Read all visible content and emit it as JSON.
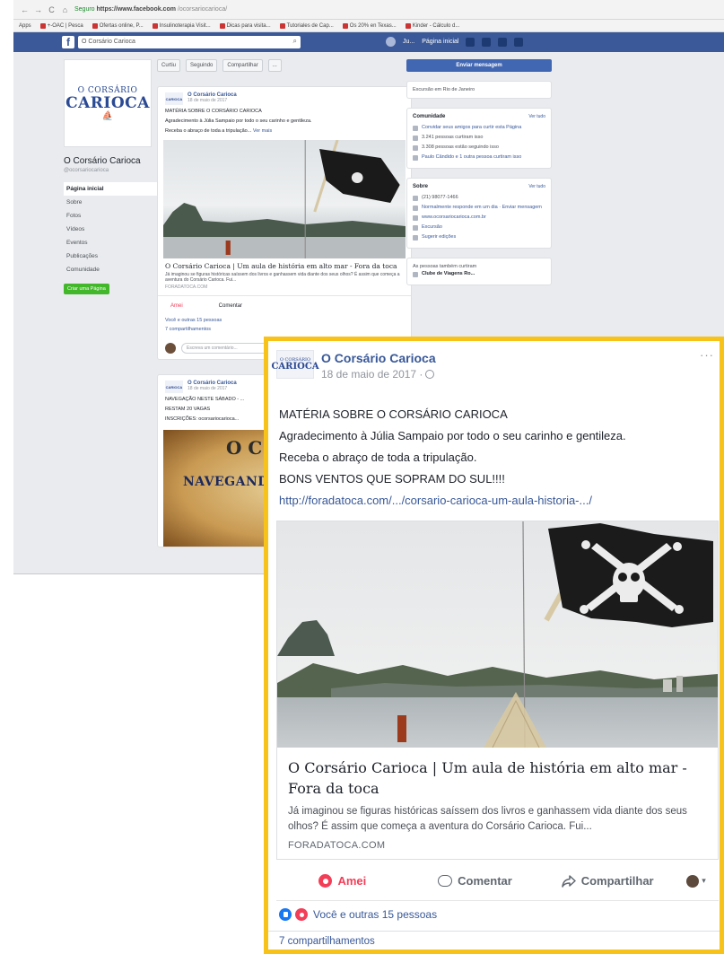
{
  "browser": {
    "nav_buttons": [
      "←",
      "→",
      "C",
      "⌂"
    ],
    "secure_label": "Seguro",
    "url_host": "https://www.facebook.com",
    "url_path": "/ocorsariocarioca/",
    "bookmarks": [
      "Apps",
      "+-OAC | Pesca",
      "Ofertas online, P...",
      "Insulinoterapia Visit...",
      "Dicas para visita...",
      "Tutoriales de Cap...",
      "Os 20% en Texas...",
      "Kinder - Cálculo d..."
    ]
  },
  "facebook": {
    "logo": "f",
    "search_value": "O Corsário Carioca",
    "search_icon": "search-icon",
    "user_name": "Ju...",
    "home_label": "Página inicial"
  },
  "page": {
    "logo_top": "O CORSÁRIO",
    "logo_main": "CARIOCA",
    "logo_ship": "⛵",
    "name": "O Corsário Carioca",
    "handle": "@ocorsariocarioca",
    "nav": [
      "Página inicial",
      "Sobre",
      "Fotos",
      "Vídeos",
      "Eventos",
      "Publicações",
      "Comunidade"
    ],
    "create_page_label": "Criar uma Página"
  },
  "actions": {
    "curtir": "Curtiu",
    "seguir": "Seguindo",
    "compartilhar": "Compartilhar",
    "more": "..."
  },
  "bg_post1": {
    "author": "O Corsário Carioca",
    "date": "18 de maio de 2017",
    "lines": [
      "MATÉRIA SOBRE O CORSÁRIO CARIOCA",
      "Agradecimento à Júlia Sampaio por todo o seu carinho e gentileza.",
      "Receba o abraço de toda a tripulação..."
    ],
    "more": "Ver mais",
    "link_title": "O Corsário Carioca | Um aula de história em alto mar - Fora da toca",
    "link_desc": "Já imaginou se figuras históricas saíssem dos livros e ganhassem vida diante dos seus olhos? É assim que começa a aventura do Corsário Carioca. Fui...",
    "link_domain": "FORADATOCA.COM",
    "amei": "Amei",
    "comentar": "Comentar",
    "likes": "Você e outras 15 pessoas",
    "shares": "7 compartilhamentos",
    "comment_placeholder": "Escreva um comentário..."
  },
  "bg_post2": {
    "author": "O Corsário Carioca",
    "date": "18 de maio de 2017",
    "lines": [
      "NAVEGAÇÃO NESTE SÁBADO - ...",
      "RESTAM 20 VAGAS",
      "INSCRIÇÕES: ocorsariocarioca..."
    ],
    "poster_logo": "O C\nCA",
    "poster_text": "NAVEGANDO"
  },
  "right": {
    "send_message": "Enviar mensagem",
    "location": "Excursão em Rio de Janeiro",
    "community_title": "Comunidade",
    "see_all": "Ver tudo",
    "community_rows": [
      "Convidar seus amigos para curtir esta Página",
      "3.241 pessoas curtiram isso",
      "3.308 pessoas estão seguindo isso",
      "Paulo Cândido e 1 outra pessoa curtiram isso"
    ],
    "about_title": "Sobre",
    "about_rows": [
      "(21) 98077-1466",
      "Normalmente responde em um dia · Enviar mensagem",
      "www.ocorsariocarioca.com.br",
      "Excursão",
      "Sugerir edições"
    ],
    "also_like": "As pessoas também curtiram",
    "suggest_name": "Clube de Viagens Ro..."
  },
  "post": {
    "avatar_top": "O CORSÁRIO",
    "avatar_main": "CARIOCA",
    "author": "O Corsário Carioca",
    "date": "18 de maio de 2017 ·",
    "menu": "···",
    "lines": [
      "MATÉRIA SOBRE O CORSÁRIO CARIOCA",
      "Agradecimento à Júlia Sampaio por todo o seu carinho e gentileza.",
      "Receba o abraço de toda a tripulação.",
      "BONS VENTOS QUE SOPRAM DO SUL!!!!"
    ],
    "link_url": "http://foradatoca.com/.../corsario-carioca-um-aula-historia-.../",
    "link_title": "O Corsário Carioca | Um aula de história em alto mar - Fora da toca",
    "link_desc": "Já imaginou se figuras históricas saíssem dos livros e ganhassem vida diante dos seus olhos? É assim que começa a aventura do Corsário Carioca. Fui...",
    "link_domain": "FORADATOCA.COM",
    "love_label": "Amei",
    "comment_label": "Comentar",
    "share_label": "Compartilhar",
    "reactions_text": "Você e outras 15 pessoas",
    "shares_text": "7 compartilhamentos"
  },
  "colors": {
    "highlight_border": "#f7c21a",
    "facebook_blue": "#3b5998",
    "link_blue": "#385898",
    "love_red": "#f33e58"
  }
}
